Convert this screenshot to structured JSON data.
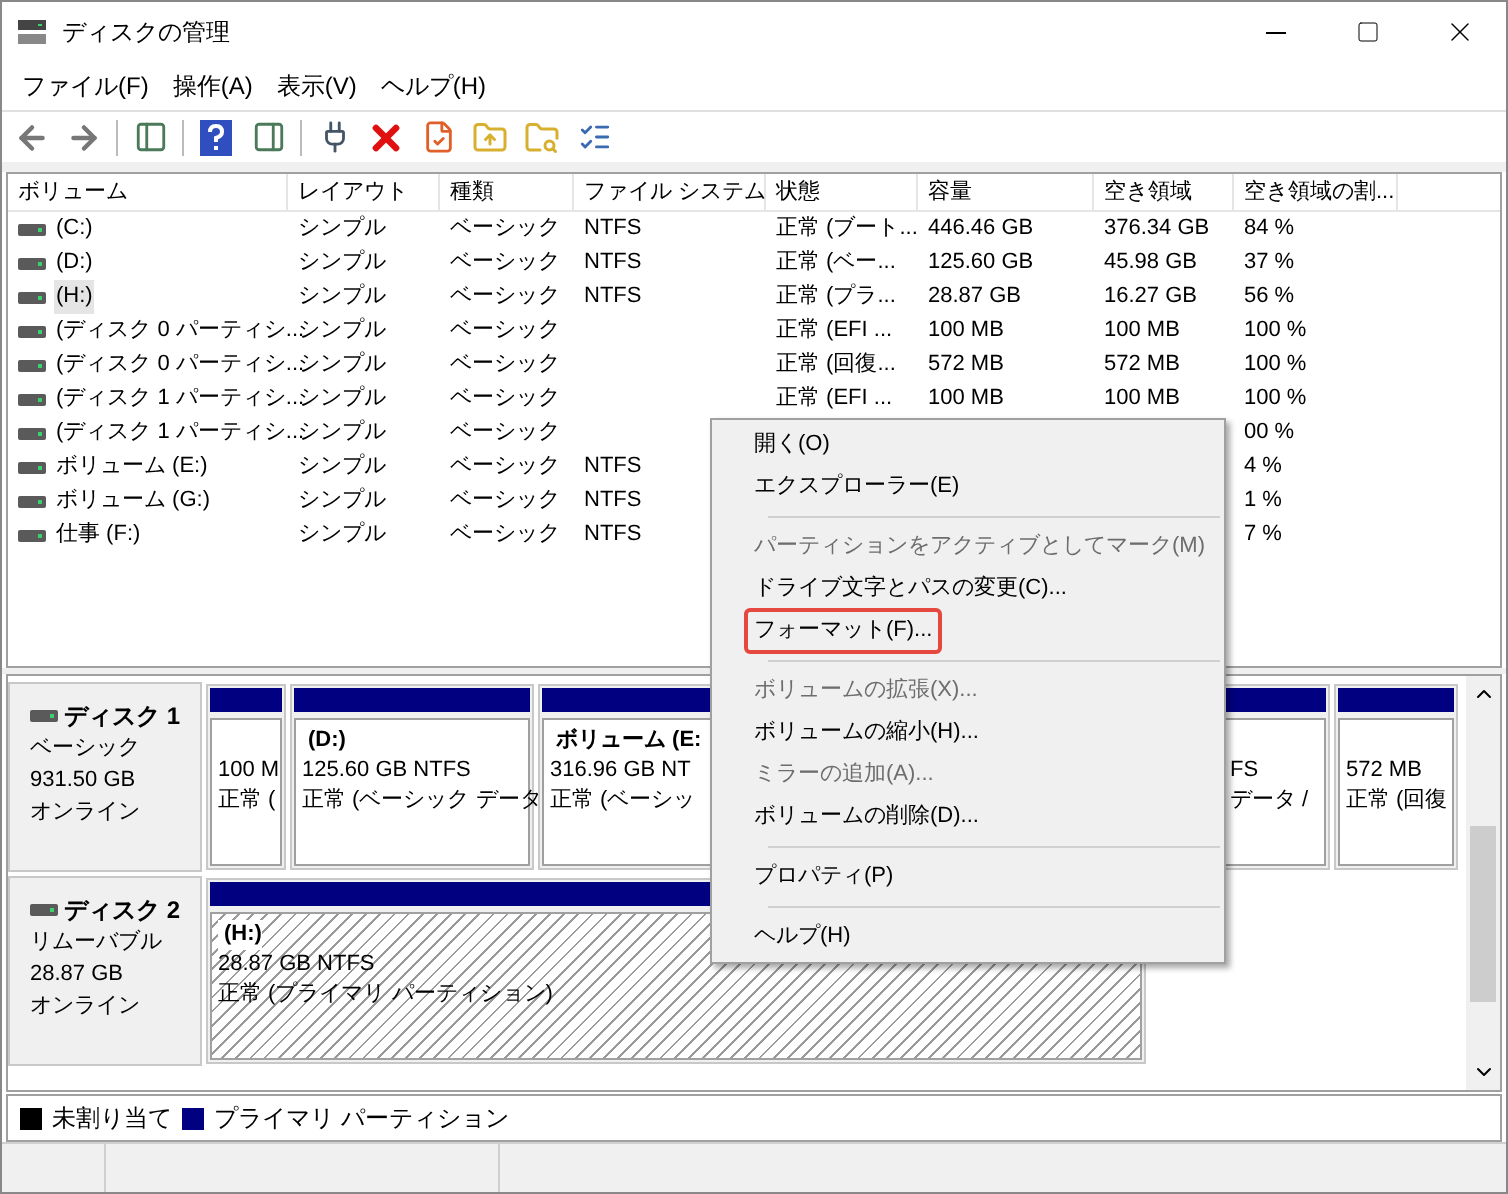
{
  "window": {
    "title": "ディスクの管理"
  },
  "menu_bar": [
    "ファイル(F)",
    "操作(A)",
    "表示(V)",
    "ヘルプ(H)"
  ],
  "volume_table": {
    "columns": [
      "ボリューム",
      "レイアウト",
      "種類",
      "ファイル システム",
      "状態",
      "容量",
      "空き領域",
      "空き領域の割..."
    ],
    "rows": [
      {
        "volume": "(C:)",
        "layout": "シンプル",
        "type": "ベーシック",
        "file_system": "NTFS",
        "status": "正常 (ブート...",
        "capacity": "446.46 GB",
        "free": "376.34 GB",
        "free_percent": "84 %",
        "selected": false
      },
      {
        "volume": "(D:)",
        "layout": "シンプル",
        "type": "ベーシック",
        "file_system": "NTFS",
        "status": "正常 (ベー...",
        "capacity": "125.60 GB",
        "free": "45.98 GB",
        "free_percent": "37 %",
        "selected": false
      },
      {
        "volume": "(H:)",
        "layout": "シンプル",
        "type": "ベーシック",
        "file_system": "NTFS",
        "status": "正常 (プラ...",
        "capacity": "28.87 GB",
        "free": "16.27 GB",
        "free_percent": "56 %",
        "selected": true
      },
      {
        "volume": "(ディスク 0 パーティシ...",
        "layout": "シンプル",
        "type": "ベーシック",
        "status": "正常 (EFI ...",
        "capacity": "100 MB",
        "free": "100 MB",
        "free_percent": "100 %",
        "selected": false
      },
      {
        "volume": "(ディスク 0 パーティシ...",
        "layout": "シンプル",
        "type": "ベーシック",
        "status": "正常 (回復...",
        "capacity": "572 MB",
        "free": "572 MB",
        "free_percent": "100 %",
        "selected": false
      },
      {
        "volume": "(ディスク 1 パーティシ...",
        "layout": "シンプル",
        "type": "ベーシック",
        "status": "正常 (EFI ...",
        "capacity": "100 MB",
        "free": "100 MB",
        "free_percent": "100 %",
        "selected": false
      },
      {
        "volume": "(ディスク 1 パーティシ...",
        "layout": "シンプル",
        "type": "ベーシック",
        "free_percent": "00 %",
        "selected": false
      },
      {
        "volume": "ボリューム (E:)",
        "layout": "シンプル",
        "type": "ベーシック",
        "file_system": "NTFS",
        "free_percent": "4 %",
        "selected": false
      },
      {
        "volume": "ボリューム (G:)",
        "layout": "シンプル",
        "type": "ベーシック",
        "file_system": "NTFS",
        "free_percent": "1 %",
        "selected": false
      },
      {
        "volume": "仕事 (F:)",
        "layout": "シンプル",
        "type": "ベーシック",
        "file_system": "NTFS",
        "free_percent": "7 %",
        "selected": false
      }
    ]
  },
  "disks": [
    {
      "name": "ディスク 1",
      "type": "ベーシック",
      "size": "931.50 GB",
      "status": "オンライン",
      "partitions": [
        {
          "size": "100 M",
          "status": "正常 (",
          "selected": false
        },
        {
          "name": "(D:)",
          "size": "125.60 GB NTFS",
          "status": "正常 (ベーシック データ",
          "selected": false
        },
        {
          "name": "ボリューム (E:",
          "size": "316.96 GB NT",
          "status": "正常 (ベーシッ",
          "selected": false
        },
        {
          "size": "FS",
          "status": "データ /",
          "selected": false
        },
        {
          "size": "572 MB",
          "status": "正常 (回復",
          "selected": false
        }
      ]
    },
    {
      "name": "ディスク 2",
      "type": "リムーバブル",
      "size": "28.87 GB",
      "status": "オンライン",
      "partitions": [
        {
          "name": "(H:)",
          "size": "28.87 GB NTFS",
          "status": "正常 (プライマリ パーティション)",
          "selected": true
        }
      ]
    }
  ],
  "legend": [
    {
      "label": "未割り当て",
      "color": "#000000"
    },
    {
      "label": "プライマリ パーティション",
      "color": "#000080"
    }
  ],
  "context_menu": [
    {
      "kind": "item",
      "label": "開く(O)",
      "disabled": false,
      "highlighted": false
    },
    {
      "kind": "item",
      "label": "エクスプローラー(E)",
      "disabled": false,
      "highlighted": false
    },
    {
      "kind": "separator"
    },
    {
      "kind": "item",
      "label": "パーティションをアクティブとしてマーク(M)",
      "disabled": true,
      "highlighted": false
    },
    {
      "kind": "item",
      "label": "ドライブ文字とパスの変更(C)...",
      "disabled": false,
      "highlighted": false
    },
    {
      "kind": "item",
      "label": "フォーマット(F)...",
      "disabled": false,
      "highlighted": true
    },
    {
      "kind": "separator"
    },
    {
      "kind": "item",
      "label": "ボリュームの拡張(X)...",
      "disabled": true,
      "highlighted": false
    },
    {
      "kind": "item",
      "label": "ボリュームの縮小(H)...",
      "disabled": false,
      "highlighted": false
    },
    {
      "kind": "item",
      "label": "ミラーの追加(A)...",
      "disabled": true,
      "highlighted": false
    },
    {
      "kind": "item",
      "label": "ボリュームの削除(D)...",
      "disabled": false,
      "highlighted": false
    },
    {
      "kind": "separator"
    },
    {
      "kind": "item",
      "label": "プロパティ(P)",
      "disabled": false,
      "highlighted": false
    },
    {
      "kind": "separator"
    },
    {
      "kind": "item",
      "label": "ヘルプ(H)",
      "disabled": false,
      "highlighted": false
    }
  ]
}
